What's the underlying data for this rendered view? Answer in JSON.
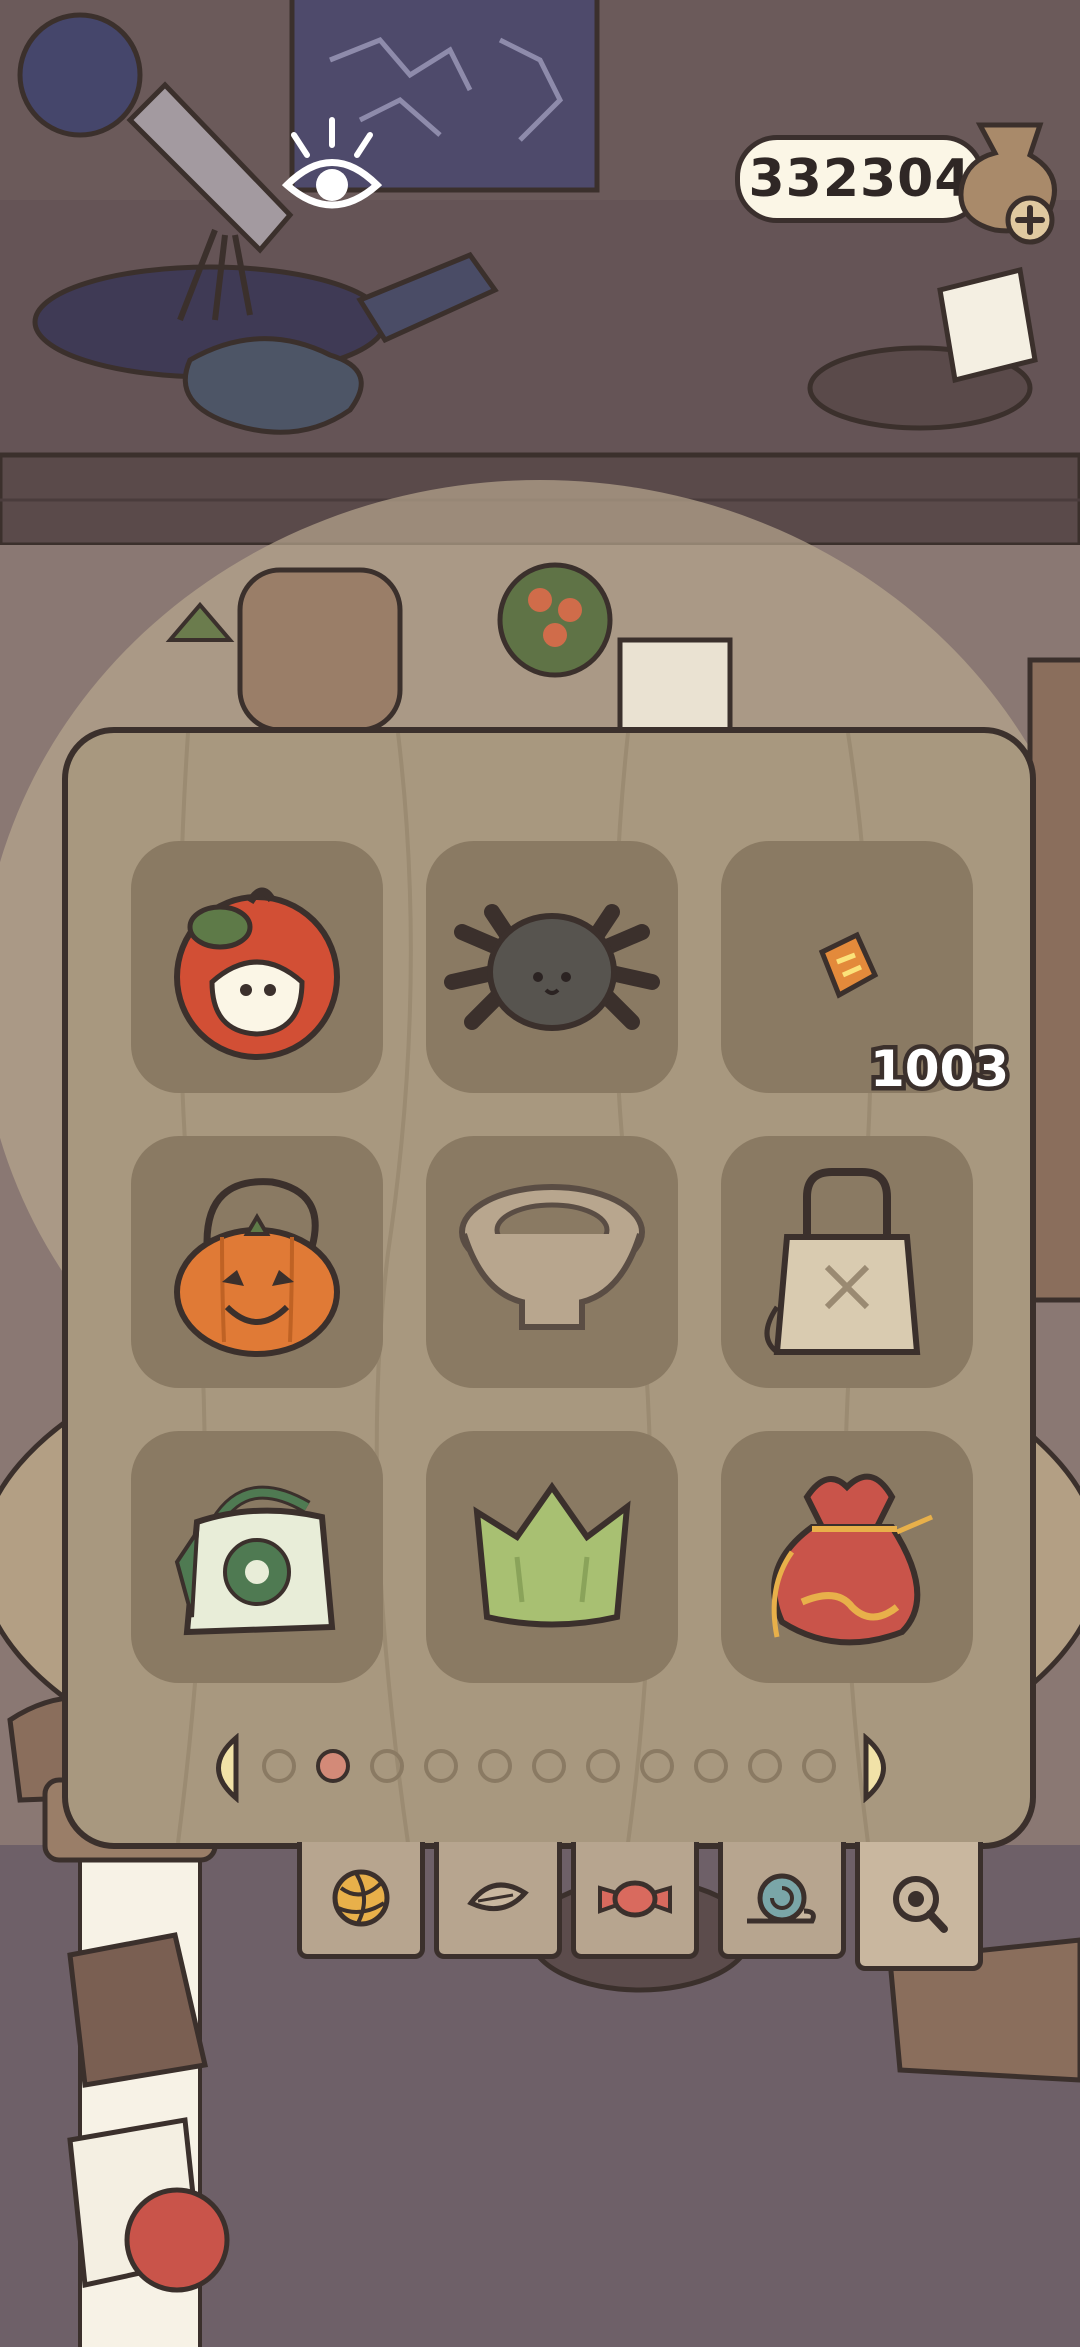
{
  "hud": {
    "coin_count": "332304",
    "add_coins_icon": "plus-icon",
    "currency_icon": "coin-pouch-icon"
  },
  "scene": {
    "view_toggle_icon": "eye-icon"
  },
  "inventory": {
    "items": [
      {
        "name": "apple-pumpkin-hat",
        "icon": "apple-icon"
      },
      {
        "name": "spider",
        "icon": "spider-icon"
      },
      {
        "name": "ticket",
        "icon": "ticket-icon",
        "count": "1003"
      },
      {
        "name": "pumpkin-basket",
        "icon": "pumpkin-basket-icon"
      },
      {
        "name": "stone-bowl",
        "icon": "bowl-icon"
      },
      {
        "name": "tote-bag",
        "icon": "bag-icon"
      },
      {
        "name": "flower-tote-bag",
        "icon": "flower-bag-icon"
      },
      {
        "name": "leaf-crown",
        "icon": "crown-icon"
      },
      {
        "name": "pouch",
        "icon": "pouch-icon"
      }
    ],
    "page_count": 11,
    "current_page": 2
  },
  "tabs": [
    {
      "icon": "yarn-icon",
      "active": false
    },
    {
      "icon": "leaf-icon",
      "active": false
    },
    {
      "icon": "candy-icon",
      "active": false
    },
    {
      "icon": "snail-icon",
      "active": false
    },
    {
      "icon": "search-icon",
      "active": true
    }
  ],
  "colors": {
    "panel": "#a8987f",
    "slot": "#8a7a63",
    "outline": "#3b302c",
    "active_dot": "#d38a78"
  }
}
